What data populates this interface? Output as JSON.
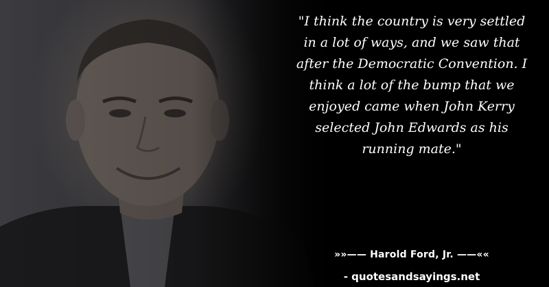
{
  "quote": {
    "text": "\"I think the country is very settled in a lot of ways, and we saw that after the Democratic Convention. I think a lot of the bump that we enjoyed came when John Kerry selected John Edwards as his running mate.\""
  },
  "author": {
    "line": "»»—— Harold Ford, Jr. ——««"
  },
  "site": {
    "text": "- quotesandsayings.net"
  },
  "colors": {
    "background": "#000000",
    "text": "#ffffff"
  }
}
